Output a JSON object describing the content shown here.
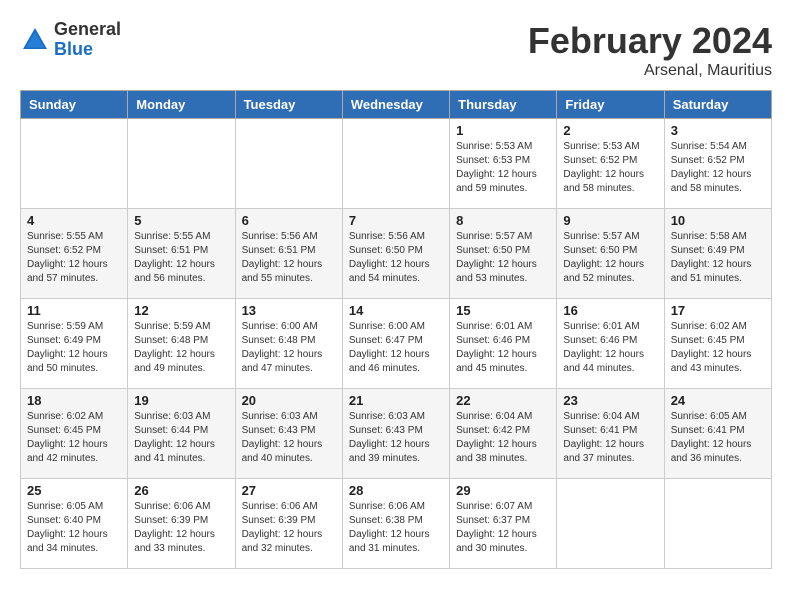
{
  "app": {
    "logo_general": "General",
    "logo_blue": "Blue"
  },
  "header": {
    "title": "February 2024",
    "subtitle": "Arsenal, Mauritius"
  },
  "columns": [
    "Sunday",
    "Monday",
    "Tuesday",
    "Wednesday",
    "Thursday",
    "Friday",
    "Saturday"
  ],
  "weeks": [
    [
      {
        "day": "",
        "info": ""
      },
      {
        "day": "",
        "info": ""
      },
      {
        "day": "",
        "info": ""
      },
      {
        "day": "",
        "info": ""
      },
      {
        "day": "1",
        "info": "Sunrise: 5:53 AM\nSunset: 6:53 PM\nDaylight: 12 hours\nand 59 minutes."
      },
      {
        "day": "2",
        "info": "Sunrise: 5:53 AM\nSunset: 6:52 PM\nDaylight: 12 hours\nand 58 minutes."
      },
      {
        "day": "3",
        "info": "Sunrise: 5:54 AM\nSunset: 6:52 PM\nDaylight: 12 hours\nand 58 minutes."
      }
    ],
    [
      {
        "day": "4",
        "info": "Sunrise: 5:55 AM\nSunset: 6:52 PM\nDaylight: 12 hours\nand 57 minutes."
      },
      {
        "day": "5",
        "info": "Sunrise: 5:55 AM\nSunset: 6:51 PM\nDaylight: 12 hours\nand 56 minutes."
      },
      {
        "day": "6",
        "info": "Sunrise: 5:56 AM\nSunset: 6:51 PM\nDaylight: 12 hours\nand 55 minutes."
      },
      {
        "day": "7",
        "info": "Sunrise: 5:56 AM\nSunset: 6:50 PM\nDaylight: 12 hours\nand 54 minutes."
      },
      {
        "day": "8",
        "info": "Sunrise: 5:57 AM\nSunset: 6:50 PM\nDaylight: 12 hours\nand 53 minutes."
      },
      {
        "day": "9",
        "info": "Sunrise: 5:57 AM\nSunset: 6:50 PM\nDaylight: 12 hours\nand 52 minutes."
      },
      {
        "day": "10",
        "info": "Sunrise: 5:58 AM\nSunset: 6:49 PM\nDaylight: 12 hours\nand 51 minutes."
      }
    ],
    [
      {
        "day": "11",
        "info": "Sunrise: 5:59 AM\nSunset: 6:49 PM\nDaylight: 12 hours\nand 50 minutes."
      },
      {
        "day": "12",
        "info": "Sunrise: 5:59 AM\nSunset: 6:48 PM\nDaylight: 12 hours\nand 49 minutes."
      },
      {
        "day": "13",
        "info": "Sunrise: 6:00 AM\nSunset: 6:48 PM\nDaylight: 12 hours\nand 47 minutes."
      },
      {
        "day": "14",
        "info": "Sunrise: 6:00 AM\nSunset: 6:47 PM\nDaylight: 12 hours\nand 46 minutes."
      },
      {
        "day": "15",
        "info": "Sunrise: 6:01 AM\nSunset: 6:46 PM\nDaylight: 12 hours\nand 45 minutes."
      },
      {
        "day": "16",
        "info": "Sunrise: 6:01 AM\nSunset: 6:46 PM\nDaylight: 12 hours\nand 44 minutes."
      },
      {
        "day": "17",
        "info": "Sunrise: 6:02 AM\nSunset: 6:45 PM\nDaylight: 12 hours\nand 43 minutes."
      }
    ],
    [
      {
        "day": "18",
        "info": "Sunrise: 6:02 AM\nSunset: 6:45 PM\nDaylight: 12 hours\nand 42 minutes."
      },
      {
        "day": "19",
        "info": "Sunrise: 6:03 AM\nSunset: 6:44 PM\nDaylight: 12 hours\nand 41 minutes."
      },
      {
        "day": "20",
        "info": "Sunrise: 6:03 AM\nSunset: 6:43 PM\nDaylight: 12 hours\nand 40 minutes."
      },
      {
        "day": "21",
        "info": "Sunrise: 6:03 AM\nSunset: 6:43 PM\nDaylight: 12 hours\nand 39 minutes."
      },
      {
        "day": "22",
        "info": "Sunrise: 6:04 AM\nSunset: 6:42 PM\nDaylight: 12 hours\nand 38 minutes."
      },
      {
        "day": "23",
        "info": "Sunrise: 6:04 AM\nSunset: 6:41 PM\nDaylight: 12 hours\nand 37 minutes."
      },
      {
        "day": "24",
        "info": "Sunrise: 6:05 AM\nSunset: 6:41 PM\nDaylight: 12 hours\nand 36 minutes."
      }
    ],
    [
      {
        "day": "25",
        "info": "Sunrise: 6:05 AM\nSunset: 6:40 PM\nDaylight: 12 hours\nand 34 minutes."
      },
      {
        "day": "26",
        "info": "Sunrise: 6:06 AM\nSunset: 6:39 PM\nDaylight: 12 hours\nand 33 minutes."
      },
      {
        "day": "27",
        "info": "Sunrise: 6:06 AM\nSunset: 6:39 PM\nDaylight: 12 hours\nand 32 minutes."
      },
      {
        "day": "28",
        "info": "Sunrise: 6:06 AM\nSunset: 6:38 PM\nDaylight: 12 hours\nand 31 minutes."
      },
      {
        "day": "29",
        "info": "Sunrise: 6:07 AM\nSunset: 6:37 PM\nDaylight: 12 hours\nand 30 minutes."
      },
      {
        "day": "",
        "info": ""
      },
      {
        "day": "",
        "info": ""
      }
    ]
  ]
}
